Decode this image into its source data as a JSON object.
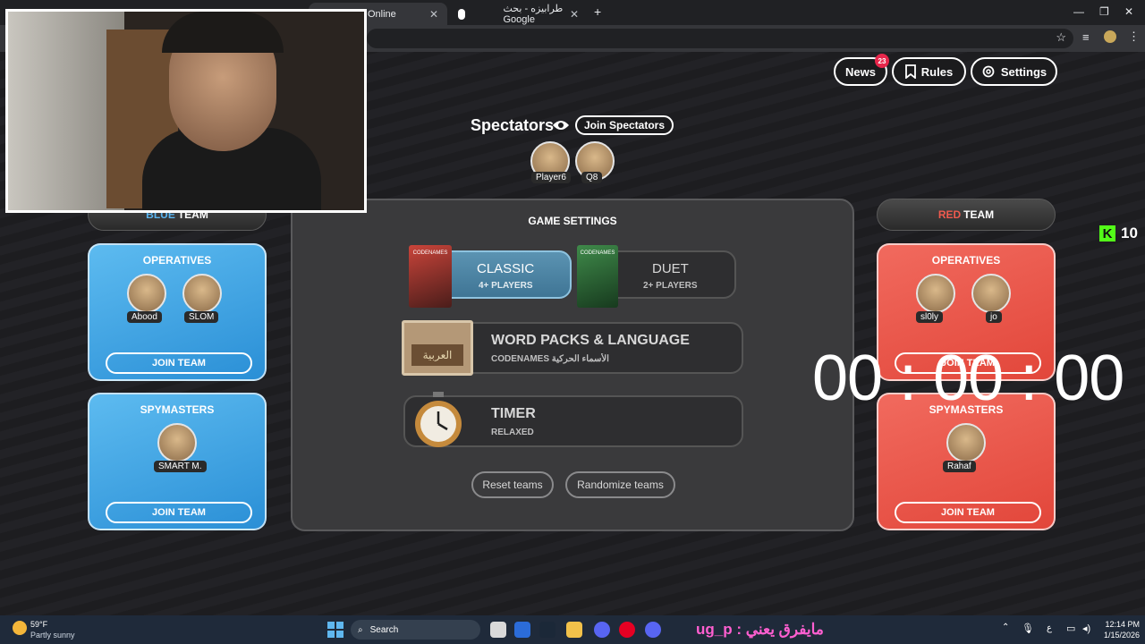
{
  "browser": {
    "tabs": [
      {
        "label": "Online",
        "active": true
      },
      {
        "label": "طرابيزه - بحث Google",
        "active": false
      }
    ],
    "new_tab": "+",
    "window_controls": {
      "minimize": "—",
      "maximize": "❐",
      "close": "✕"
    }
  },
  "header_buttons": {
    "news": "News",
    "news_count": "23",
    "rules": "Rules",
    "settings": "Settings"
  },
  "spectators": {
    "title": "Spectators",
    "join": "Join Spectators",
    "players": [
      "Player6",
      "Q8"
    ]
  },
  "blue_team": {
    "header_colored": "BLUE",
    "header_rest": "TEAM",
    "operatives_title": "OPERATIVES",
    "operatives": [
      "Abood",
      "SLOM"
    ],
    "spymasters_title": "SPYMASTERS",
    "spymasters": [
      "SMART M."
    ],
    "join": "JOIN TEAM"
  },
  "red_team": {
    "header_colored": "RED",
    "header_rest": "TEAM",
    "operatives_title": "OPERATIVES",
    "operatives": [
      "sl0ly",
      "jo"
    ],
    "spymasters_title": "SPYMASTERS",
    "spymasters": [
      "Rahaf"
    ],
    "join": "JOIN TEAM"
  },
  "game_settings": {
    "title": "GAME SETTINGS",
    "classic": {
      "title": "CLASSIC",
      "sub": "4+ PLAYERS",
      "selected": true
    },
    "duet": {
      "title": "DUET",
      "sub": "2+ PLAYERS"
    },
    "word_packs": {
      "title": "WORD PACKS & LANGUAGE",
      "sub": "CODENAMES الأسماء الحركية",
      "box_label": "العربية"
    },
    "timer": {
      "title": "TIMER",
      "sub": "RELAXED"
    },
    "reset": "Reset teams",
    "randomize": "Randomize teams",
    "box_codenames": "CODENAMES"
  },
  "overlay": {
    "timer": "00 : 00 : 00",
    "kick_count": "10"
  },
  "taskbar": {
    "weather_temp": "59°F",
    "weather_desc": "Partly sunny",
    "search": "Search",
    "overlay_text": "ug_p : مايفرق يعني",
    "time": "12:14 PM",
    "date": "1/15/2026",
    "lang": "ع"
  },
  "colors": {
    "blue_accent": "#5ab4ef",
    "red_accent": "#ef5a4e",
    "kick_green": "#53fc18"
  }
}
